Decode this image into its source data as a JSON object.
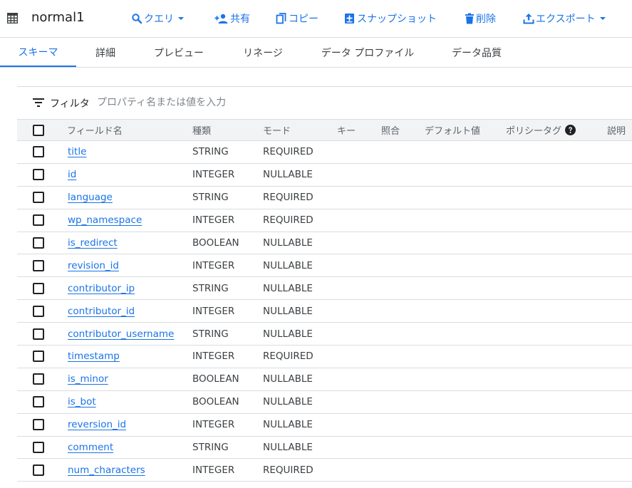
{
  "header": {
    "title": "normal1",
    "icon": "table-icon",
    "buttons": [
      {
        "id": "query",
        "label": "クエリ",
        "icon": "search-icon",
        "dropdown": true
      },
      {
        "id": "share",
        "label": "共有",
        "icon": "person-add-icon",
        "dropdown": false
      },
      {
        "id": "copy",
        "label": "コピー",
        "icon": "copy-icon",
        "dropdown": false
      },
      {
        "id": "snapshot",
        "label": "スナップショット",
        "icon": "snapshot-icon",
        "dropdown": false
      },
      {
        "id": "delete",
        "label": "削除",
        "icon": "trash-icon",
        "dropdown": false
      },
      {
        "id": "export",
        "label": "エクスポート",
        "icon": "export-icon",
        "dropdown": true
      }
    ]
  },
  "tabs": [
    {
      "label": "スキーマ",
      "active": true
    },
    {
      "label": "詳細",
      "active": false
    },
    {
      "label": "プレビュー",
      "active": false
    },
    {
      "label": "リネージ",
      "active": false
    },
    {
      "label": "データ プロファイル",
      "active": false
    },
    {
      "label": "データ品質",
      "active": false
    }
  ],
  "filter": {
    "label": "フィルタ",
    "placeholder": "プロパティ名または値を入力"
  },
  "table": {
    "columns": [
      "フィールド名",
      "種類",
      "モード",
      "キー",
      "照合",
      "デフォルト値",
      "ポリシータグ",
      "説明"
    ],
    "rows": [
      {
        "name": "title",
        "type": "STRING",
        "mode": "REQUIRED"
      },
      {
        "name": "id",
        "type": "INTEGER",
        "mode": "NULLABLE"
      },
      {
        "name": "language",
        "type": "STRING",
        "mode": "REQUIRED"
      },
      {
        "name": "wp_namespace",
        "type": "INTEGER",
        "mode": "REQUIRED"
      },
      {
        "name": "is_redirect",
        "type": "BOOLEAN",
        "mode": "NULLABLE"
      },
      {
        "name": "revision_id",
        "type": "INTEGER",
        "mode": "NULLABLE"
      },
      {
        "name": "contributor_ip",
        "type": "STRING",
        "mode": "NULLABLE"
      },
      {
        "name": "contributor_id",
        "type": "INTEGER",
        "mode": "NULLABLE"
      },
      {
        "name": "contributor_username",
        "type": "STRING",
        "mode": "NULLABLE"
      },
      {
        "name": "timestamp",
        "type": "INTEGER",
        "mode": "REQUIRED"
      },
      {
        "name": "is_minor",
        "type": "BOOLEAN",
        "mode": "NULLABLE"
      },
      {
        "name": "is_bot",
        "type": "BOOLEAN",
        "mode": "NULLABLE"
      },
      {
        "name": "reversion_id",
        "type": "INTEGER",
        "mode": "NULLABLE"
      },
      {
        "name": "comment",
        "type": "STRING",
        "mode": "NULLABLE"
      },
      {
        "name": "num_characters",
        "type": "INTEGER",
        "mode": "REQUIRED"
      }
    ]
  },
  "colors": {
    "accent": "#1a73e8",
    "text": "#202124",
    "border": "#dadce0",
    "header_bg": "#f1f3f4"
  }
}
